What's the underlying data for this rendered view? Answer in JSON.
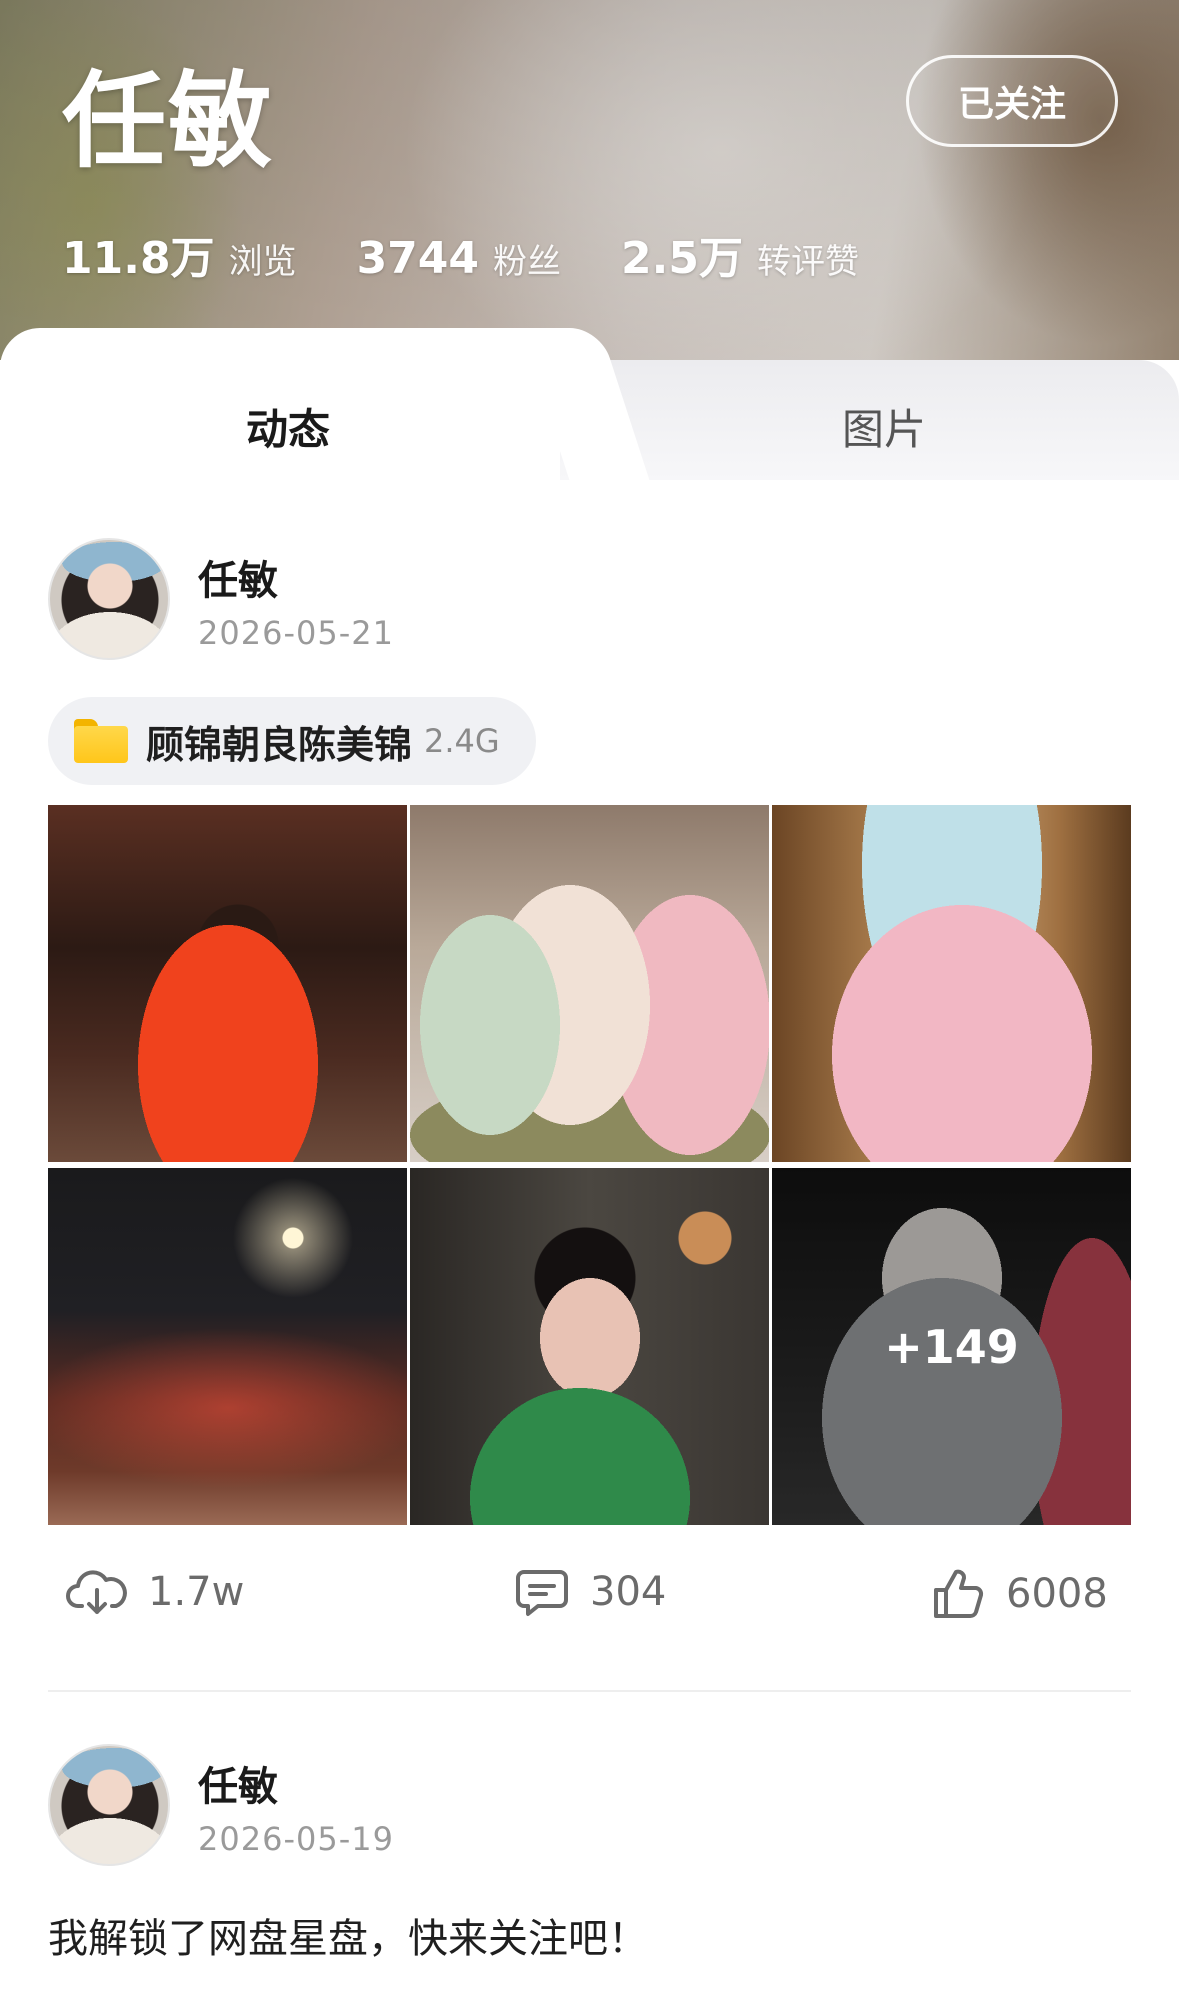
{
  "profile": {
    "name": "任敏",
    "follow_button": "已关注",
    "stats": [
      {
        "value": "11.8万",
        "label": "浏览"
      },
      {
        "value": "3744",
        "label": "粉丝"
      },
      {
        "value": "2.5万",
        "label": "转评赞"
      }
    ]
  },
  "tabs": [
    {
      "label": "动态",
      "active": true
    },
    {
      "label": "图片",
      "active": false
    }
  ],
  "posts": [
    {
      "author": "任敏",
      "date": "2026-05-21",
      "file": {
        "name": "顾锦朝良陈美锦",
        "size": "2.4G",
        "icon": "folder-icon"
      },
      "photos_more": "+149",
      "actions": {
        "downloads": "1.7w",
        "comments": "304",
        "likes": "6008"
      }
    },
    {
      "author": "任敏",
      "date": "2026-05-19",
      "text": "我解锁了网盘星盘，快来关注吧！"
    }
  ],
  "colors": {
    "accent_text": "#1a1a1a",
    "muted": "#9a9a9a",
    "folder": "#ffc61a"
  }
}
